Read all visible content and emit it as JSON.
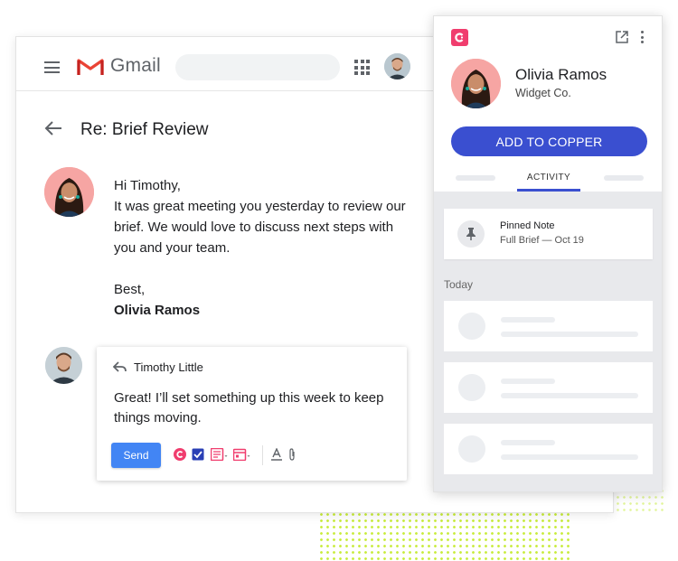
{
  "gmail": {
    "app_name": "Gmail",
    "subject": "Re: Brief Review",
    "message": {
      "greeting": "Hi Timothy,",
      "body": "It was great meeting you yesterday to review our brief. We would love to discuss next steps with you and your team.",
      "closing": "Best,",
      "signature": "Olivia Ramos"
    },
    "reply": {
      "sender": "Timothy Little",
      "text": "Great! I’ll set something up this week to keep things moving.",
      "send_label": "Send"
    }
  },
  "copper": {
    "contact": {
      "name": "Olivia Ramos",
      "company": "Widget Co."
    },
    "add_button_label": "ADD TO COPPER",
    "active_tab": "ACTIVITY",
    "pinned_note": {
      "title": "Pinned Note",
      "subtitle": "Full Brief — Oct 19"
    },
    "section_label": "Today"
  },
  "colors": {
    "gmail_red": "#EA4335",
    "copper_pink": "#F03D6E",
    "copper_blue": "#3A4FD0",
    "send_blue": "#4285F4",
    "accent_dots": "#C8EC3A"
  },
  "icons": [
    "menu-icon",
    "gmail-logo-icon",
    "apps-grid-icon",
    "back-arrow-icon",
    "reply-icon",
    "copper-icon",
    "checkbox-icon",
    "note-icon",
    "calendar-icon",
    "text-format-icon",
    "attach-icon",
    "external-link-icon",
    "more-vert-icon",
    "pin-icon"
  ]
}
